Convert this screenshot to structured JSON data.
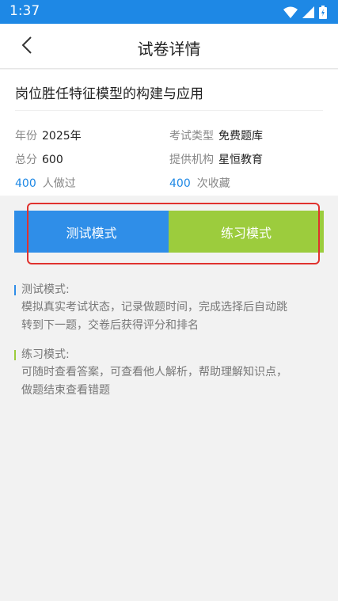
{
  "status_bar": {
    "time": "1:37"
  },
  "header": {
    "title": "试卷详情"
  },
  "exam": {
    "title": "岗位胜任特征模型的构建与应用",
    "year_label": "年份",
    "year_value": "2025年",
    "type_label": "考试类型",
    "type_value": "免费题库",
    "score_label": "总分",
    "score_value": "600",
    "provider_label": "提供机构",
    "provider_value": "星恒教育",
    "done_count": "400",
    "done_label": "人做过",
    "fav_count": "400",
    "fav_label": "次收藏"
  },
  "modes": {
    "test_label": "测试模式",
    "practice_label": "练习模式"
  },
  "descriptions": {
    "test_title": "测试模式:",
    "test_line1": "模拟真实考试状态，记录做题时间，完成选择后自动跳",
    "test_line2": "转到下一题，交卷后获得评分和排名",
    "practice_title": "练习模式:",
    "practice_line1": "可随时查看答案，可查看他人解析，帮助理解知识点，",
    "practice_line2": "做题结束查看错题"
  },
  "colors": {
    "status_bar": "#1e88e5",
    "test_button": "#2f8ee8",
    "practice_button": "#9ccc3d",
    "highlight": "#e0322e",
    "accent_number": "#1e88e5"
  },
  "icons": [
    "wifi-icon",
    "signal-icon",
    "battery-icon",
    "back-arrow-icon"
  ]
}
